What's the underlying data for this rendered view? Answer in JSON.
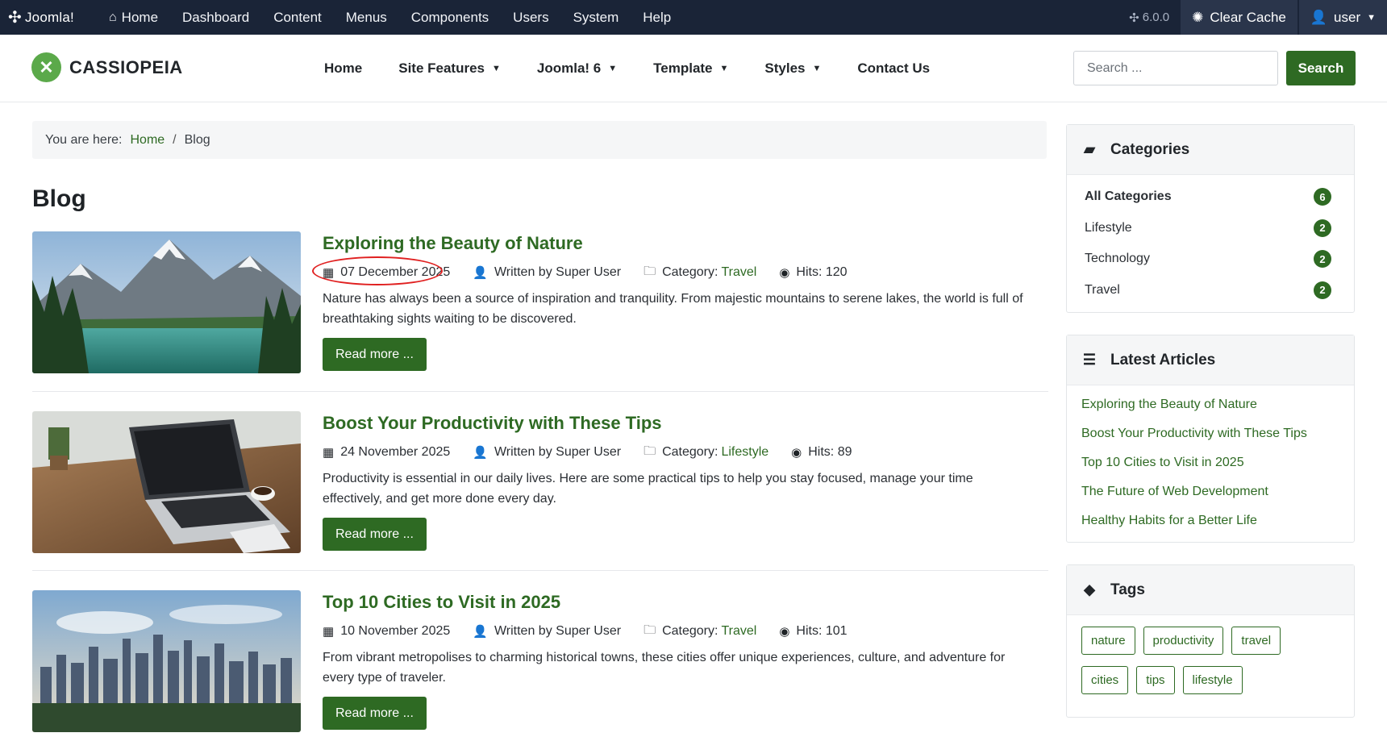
{
  "adminbar": {
    "brand": "Joomla!",
    "nav": [
      "Home",
      "Dashboard",
      "Content",
      "Menus",
      "Components",
      "Users",
      "System",
      "Help"
    ],
    "version": "6.0.0",
    "clear_cache": "Clear Cache",
    "user": "user"
  },
  "site": {
    "logo_text": "CASSIOPEIA",
    "nav": [
      {
        "label": "Home",
        "has_dropdown": false
      },
      {
        "label": "Site Features",
        "has_dropdown": true
      },
      {
        "label": "Joomla! 6",
        "has_dropdown": true
      },
      {
        "label": "Template",
        "has_dropdown": true
      },
      {
        "label": "Styles",
        "has_dropdown": true
      },
      {
        "label": "Contact Us",
        "has_dropdown": false
      }
    ],
    "search_placeholder": "Search ...",
    "search_button": "Search"
  },
  "breadcrumb": {
    "prefix": "You are here:",
    "home": "Home",
    "separator": "/",
    "current": "Blog"
  },
  "page_title": "Blog",
  "articles": [
    {
      "title": "Exploring the Beauty of Nature",
      "date": "07 December 2025",
      "author": "Written by Super User",
      "category_label": "Category:",
      "category": "Travel",
      "hits": "Hits: 120",
      "text": "Nature has always been a source of inspiration and tranquility. From majestic mountains to serene lakes, the world is full of breathtaking sights waiting to be discovered.",
      "read_more": "Read more ..."
    },
    {
      "title": "Boost Your Productivity with These Tips",
      "date": "24 November 2025",
      "author": "Written by Super User",
      "category_label": "Category:",
      "category": "Lifestyle",
      "hits": "Hits: 89",
      "text": "Productivity is essential in our daily lives. Here are some practical tips to help you stay focused, manage your time effectively, and get more done every day.",
      "read_more": "Read more ..."
    },
    {
      "title": "Top 10 Cities to Visit in 2025",
      "date": "10 November 2025",
      "author": "Written by Super User",
      "category_label": "Category:",
      "category": "Travel",
      "hits": "Hits: 101",
      "text": "From vibrant metropolises to charming historical towns, these cities offer unique experiences, culture, and adventure for every type of traveler.",
      "read_more": "Read more ..."
    }
  ],
  "sidebar": {
    "categories": {
      "title": "Categories",
      "items": [
        {
          "label": "All Categories",
          "count": "6"
        },
        {
          "label": "Lifestyle",
          "count": "2"
        },
        {
          "label": "Technology",
          "count": "2"
        },
        {
          "label": "Travel",
          "count": "2"
        }
      ]
    },
    "latest": {
      "title": "Latest Articles",
      "items": [
        "Exploring the Beauty of Nature",
        "Boost Your Productivity with These Tips",
        "Top 10 Cities to Visit in 2025",
        "The Future of Web Development",
        "Healthy Habits for a Better Life"
      ]
    },
    "tags": {
      "title": "Tags",
      "items": [
        "nature",
        "productivity",
        "travel",
        "cities",
        "tips",
        "lifestyle"
      ]
    }
  },
  "colors": {
    "admin_bg": "#1a2437",
    "accent_green": "#2e6a23",
    "logo_green": "#5ba94a",
    "highlight": "#e02020"
  }
}
